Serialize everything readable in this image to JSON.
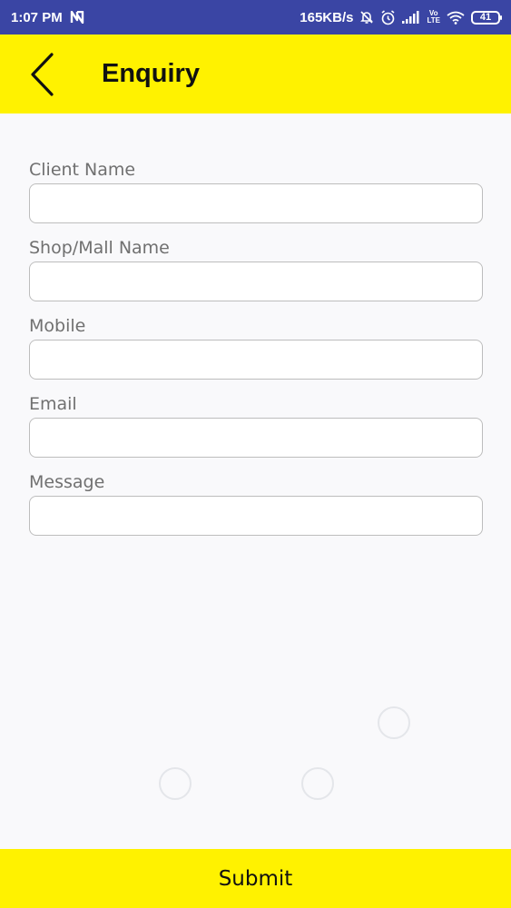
{
  "status_bar": {
    "time": "1:07 PM",
    "network_speed": "165KB/s",
    "volte_top": "Vo",
    "volte_bottom": "LTE",
    "battery": "41",
    "icons": [
      "n-notification-icon",
      "bell-muted-icon",
      "alarm-icon",
      "signal-icon",
      "volte-icon",
      "wifi-icon",
      "battery-icon"
    ]
  },
  "app_bar": {
    "title": "Enquiry",
    "back_icon": "chevron-left-icon",
    "background": "#fff200"
  },
  "form": {
    "fields": [
      {
        "label": "Client Name",
        "value": "",
        "placeholder": ""
      },
      {
        "label": "Shop/Mall Name",
        "value": "",
        "placeholder": ""
      },
      {
        "label": "Mobile",
        "value": "",
        "placeholder": ""
      },
      {
        "label": "Email",
        "value": "",
        "placeholder": ""
      },
      {
        "label": "Message",
        "value": "",
        "placeholder": ""
      }
    ]
  },
  "submit": {
    "label": "Submit"
  },
  "colors": {
    "status_bar": "#3a45a4",
    "accent": "#fff200",
    "label_text": "#707070",
    "input_border": "#bdbdbd"
  }
}
